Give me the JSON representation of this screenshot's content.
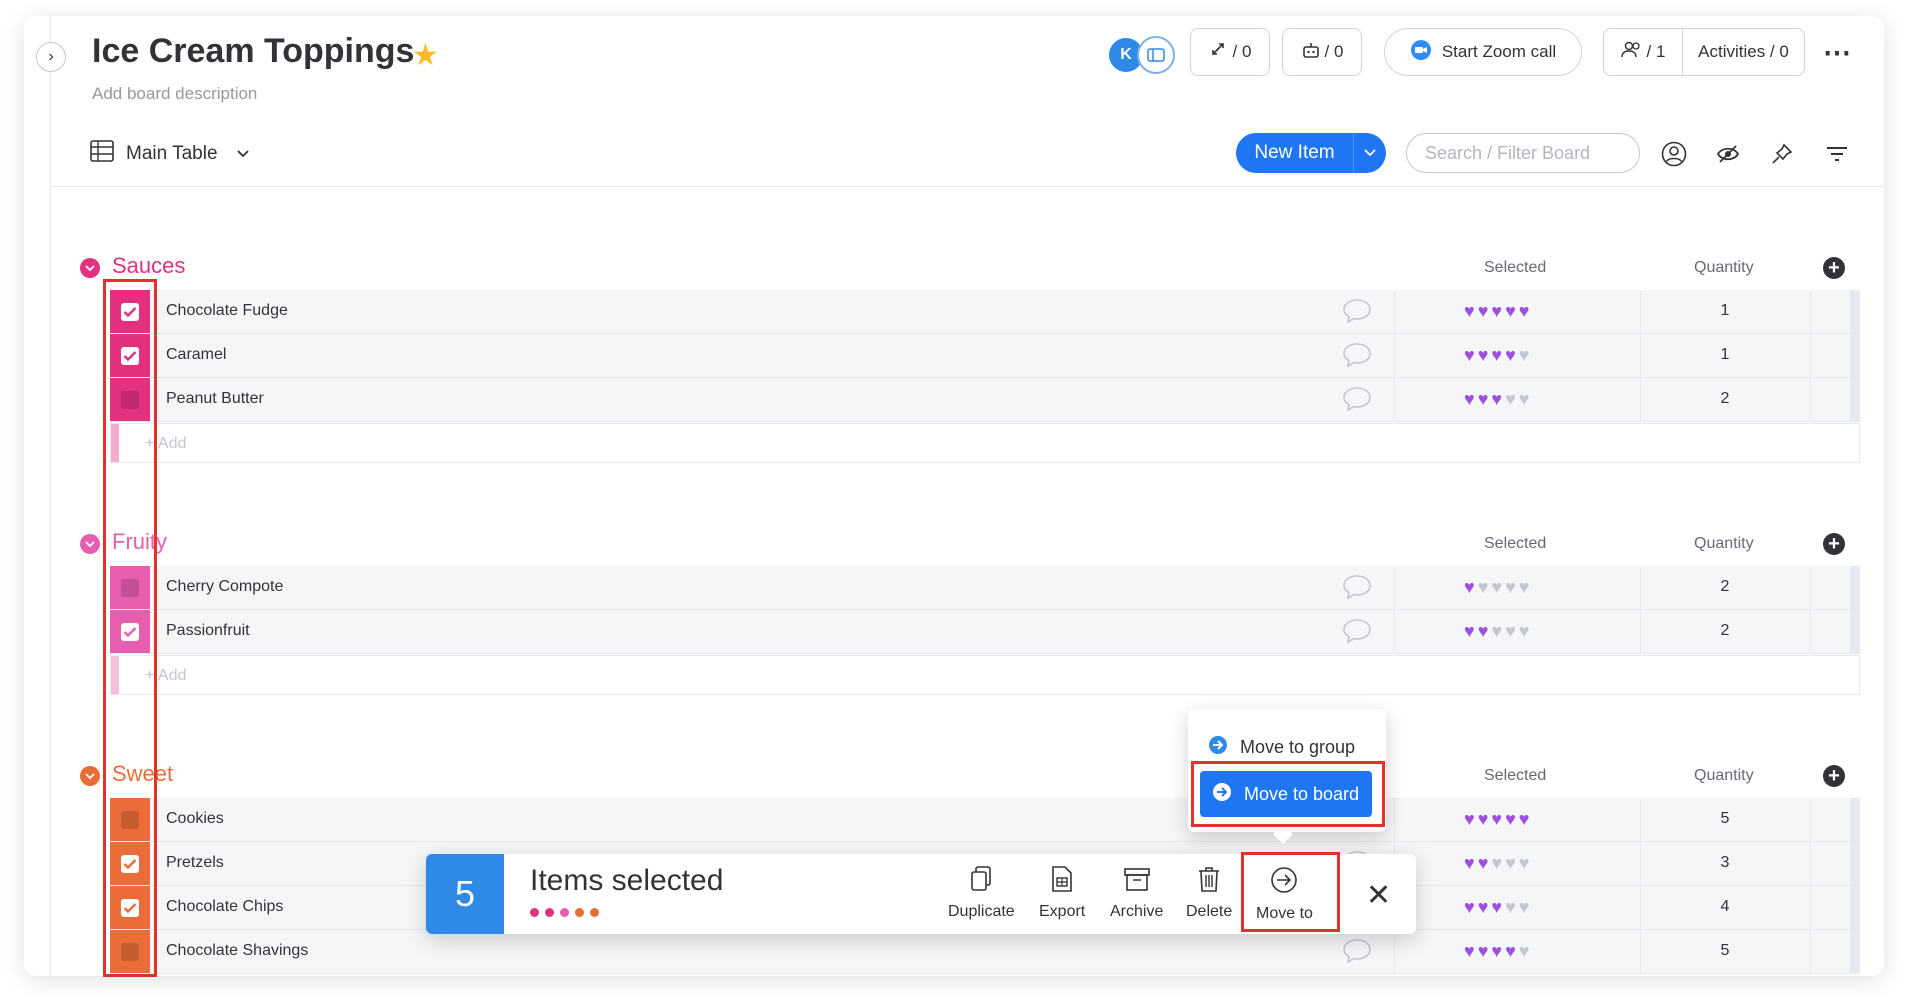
{
  "board": {
    "title": "Ice Cream Toppings",
    "description": "Add board description",
    "avatar_initial": "K",
    "updates_label": "/ 0",
    "automations_label": "/ 0",
    "zoom_label": "Start Zoom call",
    "members_label": "/ 1",
    "activities_label": "Activities / 0"
  },
  "toolbar": {
    "view_label": "Main Table",
    "new_item_label": "New Item",
    "search_placeholder": "Search / Filter Board"
  },
  "columns": {
    "selected": "Selected",
    "quantity": "Quantity"
  },
  "add_label": "+ Add",
  "colors": {
    "sauces": "#e2317f",
    "fruity": "#e65fae",
    "sweet": "#ea6d39",
    "heart_on": "#9d50dd",
    "heart_off": "#c5c7d0",
    "primary": "#1f76f2",
    "highlight": "#e2302b"
  },
  "groups": [
    {
      "name": "Sauces",
      "items": [
        {
          "name": "Chocolate Fudge",
          "rating": 5,
          "quantity": "1",
          "checked": true
        },
        {
          "name": "Caramel",
          "rating": 4,
          "quantity": "1",
          "checked": true
        },
        {
          "name": "Peanut Butter",
          "rating": 3,
          "quantity": "2",
          "checked": false
        }
      ]
    },
    {
      "name": "Fruity",
      "items": [
        {
          "name": "Cherry Compote",
          "rating": 1,
          "quantity": "2",
          "checked": false
        },
        {
          "name": "Passionfruit",
          "rating": 2,
          "quantity": "2",
          "checked": true
        }
      ]
    },
    {
      "name": "Sweet",
      "items": [
        {
          "name": "Cookies",
          "rating": 5,
          "quantity": "5",
          "checked": false
        },
        {
          "name": "Pretzels",
          "rating": 2,
          "quantity": "3",
          "checked": true
        },
        {
          "name": "Chocolate Chips",
          "rating": 3,
          "quantity": "4",
          "checked": true
        },
        {
          "name": "Chocolate Shavings",
          "rating": 4,
          "quantity": "5",
          "checked": false
        }
      ]
    }
  ],
  "move_menu": {
    "group_label": "Move to group",
    "board_label": "Move to board"
  },
  "bulk": {
    "count": "5",
    "label": "Items selected",
    "actions": [
      "Duplicate",
      "Export",
      "Archive",
      "Delete",
      "Move to"
    ]
  }
}
